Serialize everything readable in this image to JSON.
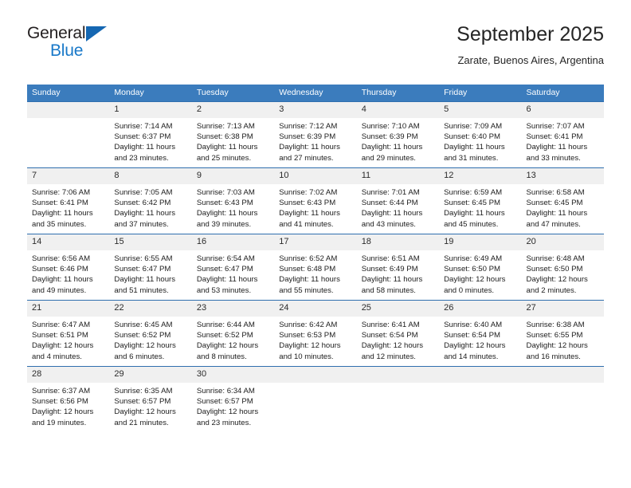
{
  "brand": {
    "name_part1": "General",
    "name_part2": "Blue",
    "accent_color": "#1878c8",
    "triangle_color": "#1567b2"
  },
  "header": {
    "title": "September 2025",
    "subtitle": "Zarate, Buenos Aires, Argentina"
  },
  "calendar": {
    "header_bg": "#3b7cbd",
    "daynum_bg": "#f0f0f0",
    "weekday_headers": [
      "Sunday",
      "Monday",
      "Tuesday",
      "Wednesday",
      "Thursday",
      "Friday",
      "Saturday"
    ],
    "weeks": [
      [
        {
          "day": "",
          "sunrise": "",
          "sunset": "",
          "daylight_line1": "",
          "daylight_line2": "",
          "empty": true
        },
        {
          "day": "1",
          "sunrise": "Sunrise: 7:14 AM",
          "sunset": "Sunset: 6:37 PM",
          "daylight_line1": "Daylight: 11 hours",
          "daylight_line2": "and 23 minutes."
        },
        {
          "day": "2",
          "sunrise": "Sunrise: 7:13 AM",
          "sunset": "Sunset: 6:38 PM",
          "daylight_line1": "Daylight: 11 hours",
          "daylight_line2": "and 25 minutes."
        },
        {
          "day": "3",
          "sunrise": "Sunrise: 7:12 AM",
          "sunset": "Sunset: 6:39 PM",
          "daylight_line1": "Daylight: 11 hours",
          "daylight_line2": "and 27 minutes."
        },
        {
          "day": "4",
          "sunrise": "Sunrise: 7:10 AM",
          "sunset": "Sunset: 6:39 PM",
          "daylight_line1": "Daylight: 11 hours",
          "daylight_line2": "and 29 minutes."
        },
        {
          "day": "5",
          "sunrise": "Sunrise: 7:09 AM",
          "sunset": "Sunset: 6:40 PM",
          "daylight_line1": "Daylight: 11 hours",
          "daylight_line2": "and 31 minutes."
        },
        {
          "day": "6",
          "sunrise": "Sunrise: 7:07 AM",
          "sunset": "Sunset: 6:41 PM",
          "daylight_line1": "Daylight: 11 hours",
          "daylight_line2": "and 33 minutes."
        }
      ],
      [
        {
          "day": "7",
          "sunrise": "Sunrise: 7:06 AM",
          "sunset": "Sunset: 6:41 PM",
          "daylight_line1": "Daylight: 11 hours",
          "daylight_line2": "and 35 minutes."
        },
        {
          "day": "8",
          "sunrise": "Sunrise: 7:05 AM",
          "sunset": "Sunset: 6:42 PM",
          "daylight_line1": "Daylight: 11 hours",
          "daylight_line2": "and 37 minutes."
        },
        {
          "day": "9",
          "sunrise": "Sunrise: 7:03 AM",
          "sunset": "Sunset: 6:43 PM",
          "daylight_line1": "Daylight: 11 hours",
          "daylight_line2": "and 39 minutes."
        },
        {
          "day": "10",
          "sunrise": "Sunrise: 7:02 AM",
          "sunset": "Sunset: 6:43 PM",
          "daylight_line1": "Daylight: 11 hours",
          "daylight_line2": "and 41 minutes."
        },
        {
          "day": "11",
          "sunrise": "Sunrise: 7:01 AM",
          "sunset": "Sunset: 6:44 PM",
          "daylight_line1": "Daylight: 11 hours",
          "daylight_line2": "and 43 minutes."
        },
        {
          "day": "12",
          "sunrise": "Sunrise: 6:59 AM",
          "sunset": "Sunset: 6:45 PM",
          "daylight_line1": "Daylight: 11 hours",
          "daylight_line2": "and 45 minutes."
        },
        {
          "day": "13",
          "sunrise": "Sunrise: 6:58 AM",
          "sunset": "Sunset: 6:45 PM",
          "daylight_line1": "Daylight: 11 hours",
          "daylight_line2": "and 47 minutes."
        }
      ],
      [
        {
          "day": "14",
          "sunrise": "Sunrise: 6:56 AM",
          "sunset": "Sunset: 6:46 PM",
          "daylight_line1": "Daylight: 11 hours",
          "daylight_line2": "and 49 minutes."
        },
        {
          "day": "15",
          "sunrise": "Sunrise: 6:55 AM",
          "sunset": "Sunset: 6:47 PM",
          "daylight_line1": "Daylight: 11 hours",
          "daylight_line2": "and 51 minutes."
        },
        {
          "day": "16",
          "sunrise": "Sunrise: 6:54 AM",
          "sunset": "Sunset: 6:47 PM",
          "daylight_line1": "Daylight: 11 hours",
          "daylight_line2": "and 53 minutes."
        },
        {
          "day": "17",
          "sunrise": "Sunrise: 6:52 AM",
          "sunset": "Sunset: 6:48 PM",
          "daylight_line1": "Daylight: 11 hours",
          "daylight_line2": "and 55 minutes."
        },
        {
          "day": "18",
          "sunrise": "Sunrise: 6:51 AM",
          "sunset": "Sunset: 6:49 PM",
          "daylight_line1": "Daylight: 11 hours",
          "daylight_line2": "and 58 minutes."
        },
        {
          "day": "19",
          "sunrise": "Sunrise: 6:49 AM",
          "sunset": "Sunset: 6:50 PM",
          "daylight_line1": "Daylight: 12 hours",
          "daylight_line2": "and 0 minutes."
        },
        {
          "day": "20",
          "sunrise": "Sunrise: 6:48 AM",
          "sunset": "Sunset: 6:50 PM",
          "daylight_line1": "Daylight: 12 hours",
          "daylight_line2": "and 2 minutes."
        }
      ],
      [
        {
          "day": "21",
          "sunrise": "Sunrise: 6:47 AM",
          "sunset": "Sunset: 6:51 PM",
          "daylight_line1": "Daylight: 12 hours",
          "daylight_line2": "and 4 minutes."
        },
        {
          "day": "22",
          "sunrise": "Sunrise: 6:45 AM",
          "sunset": "Sunset: 6:52 PM",
          "daylight_line1": "Daylight: 12 hours",
          "daylight_line2": "and 6 minutes."
        },
        {
          "day": "23",
          "sunrise": "Sunrise: 6:44 AM",
          "sunset": "Sunset: 6:52 PM",
          "daylight_line1": "Daylight: 12 hours",
          "daylight_line2": "and 8 minutes."
        },
        {
          "day": "24",
          "sunrise": "Sunrise: 6:42 AM",
          "sunset": "Sunset: 6:53 PM",
          "daylight_line1": "Daylight: 12 hours",
          "daylight_line2": "and 10 minutes."
        },
        {
          "day": "25",
          "sunrise": "Sunrise: 6:41 AM",
          "sunset": "Sunset: 6:54 PM",
          "daylight_line1": "Daylight: 12 hours",
          "daylight_line2": "and 12 minutes."
        },
        {
          "day": "26",
          "sunrise": "Sunrise: 6:40 AM",
          "sunset": "Sunset: 6:54 PM",
          "daylight_line1": "Daylight: 12 hours",
          "daylight_line2": "and 14 minutes."
        },
        {
          "day": "27",
          "sunrise": "Sunrise: 6:38 AM",
          "sunset": "Sunset: 6:55 PM",
          "daylight_line1": "Daylight: 12 hours",
          "daylight_line2": "and 16 minutes."
        }
      ],
      [
        {
          "day": "28",
          "sunrise": "Sunrise: 6:37 AM",
          "sunset": "Sunset: 6:56 PM",
          "daylight_line1": "Daylight: 12 hours",
          "daylight_line2": "and 19 minutes."
        },
        {
          "day": "29",
          "sunrise": "Sunrise: 6:35 AM",
          "sunset": "Sunset: 6:57 PM",
          "daylight_line1": "Daylight: 12 hours",
          "daylight_line2": "and 21 minutes."
        },
        {
          "day": "30",
          "sunrise": "Sunrise: 6:34 AM",
          "sunset": "Sunset: 6:57 PM",
          "daylight_line1": "Daylight: 12 hours",
          "daylight_line2": "and 23 minutes."
        },
        {
          "day": "",
          "sunrise": "",
          "sunset": "",
          "daylight_line1": "",
          "daylight_line2": "",
          "empty": true
        },
        {
          "day": "",
          "sunrise": "",
          "sunset": "",
          "daylight_line1": "",
          "daylight_line2": "",
          "empty": true
        },
        {
          "day": "",
          "sunrise": "",
          "sunset": "",
          "daylight_line1": "",
          "daylight_line2": "",
          "empty": true
        },
        {
          "day": "",
          "sunrise": "",
          "sunset": "",
          "daylight_line1": "",
          "daylight_line2": "",
          "empty": true
        }
      ]
    ]
  }
}
